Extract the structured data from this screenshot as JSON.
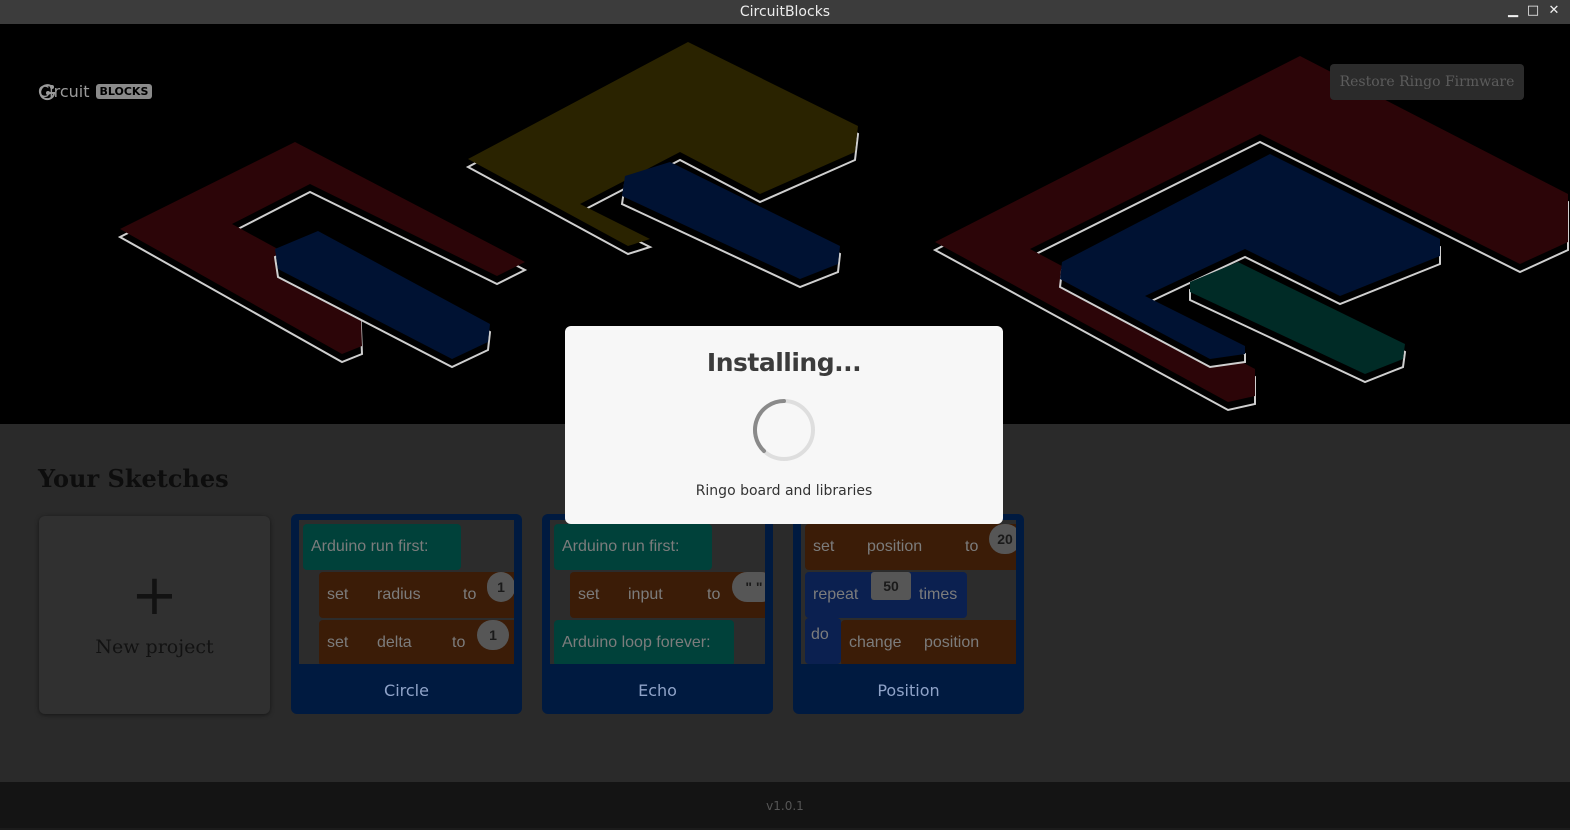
{
  "window": {
    "title": "CircuitBlocks",
    "controls": {
      "minimize": "▁",
      "maximize": "□",
      "close": "✕"
    }
  },
  "header": {
    "logo": {
      "icon": "circuit-logo-icon",
      "text": "Circuit",
      "badge": "BLOCKS"
    },
    "restore_button": "Restore Ringo Firmware"
  },
  "sketches": {
    "heading": "Your Sketches",
    "new_project": {
      "icon": "plus-icon",
      "label": "New project"
    },
    "cards": [
      {
        "name": "Circle",
        "blocks": {
          "first": "Arduino run first:",
          "set1": "set",
          "var1": "radius",
          "to1": "to",
          "val1": "1",
          "set2": "set",
          "var2": "delta",
          "to2": "to",
          "val2": "1"
        }
      },
      {
        "name": "Echo",
        "blocks": {
          "first": "Arduino run first:",
          "set1": "set",
          "var1": "input",
          "to1": "to",
          "val1": "\" \"",
          "loop": "Arduino loop forever:"
        }
      },
      {
        "name": "Position",
        "blocks": {
          "set1": "set",
          "var1": "position",
          "to1": "to",
          "val1": "20",
          "repeat": "repeat",
          "times_val": "50",
          "times": "times",
          "do": "do",
          "change": "change",
          "var2": "position"
        }
      }
    ]
  },
  "footer": {
    "version": "v1.0.1"
  },
  "modal": {
    "title": "Installing...",
    "spinner": "loading-spinner-icon",
    "message": "Ringo board and libraries"
  },
  "colors": {
    "overlay_dim": "#000000",
    "modal_bg": "#f7f7f7",
    "block_teal": "#00413a",
    "block_orange": "#3b1c07",
    "card_blue": "#001a40"
  }
}
